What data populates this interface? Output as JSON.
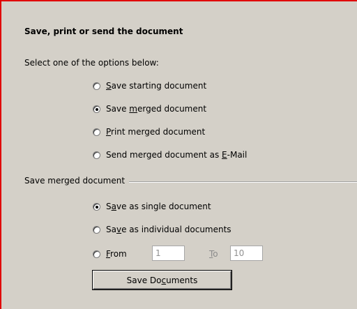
{
  "heading": "Save, print or send the document",
  "instruction": "Select one of the options below:",
  "options": [
    {
      "pre": "",
      "key": "S",
      "post": "ave starting document",
      "checked": false
    },
    {
      "pre": "Save ",
      "key": "m",
      "post": "erged document",
      "checked": true
    },
    {
      "pre": "",
      "key": "P",
      "post": "rint merged document",
      "checked": false
    },
    {
      "pre": "Send merged document as ",
      "key": "E",
      "post": "-Mail",
      "checked": false
    }
  ],
  "save_group": {
    "label": "Save merged document",
    "options": [
      {
        "pre": "S",
        "key": "a",
        "post": "ve as single document",
        "checked": true
      },
      {
        "pre": "Sa",
        "key": "v",
        "post": "e as individual documents",
        "checked": false
      }
    ],
    "range": {
      "from_pre": "",
      "from_key": "F",
      "from_post": "rom",
      "from_value": "1",
      "to_pre": "",
      "to_key": "T",
      "to_post": "o",
      "to_value": "10",
      "checked": false
    },
    "button": {
      "pre": "Save Do",
      "key": "c",
      "post": "uments"
    }
  }
}
